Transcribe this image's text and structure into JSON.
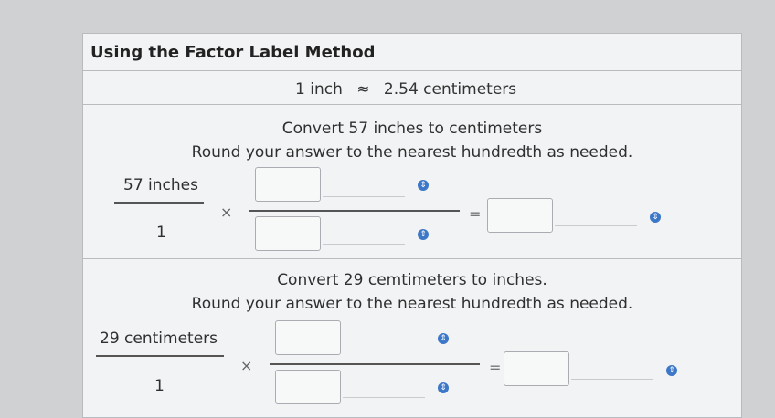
{
  "title": "Using the Factor Label Method",
  "equivalence": {
    "left": "1 inch",
    "symbol": "≈",
    "right": "2.54 centimeters"
  },
  "problem1": {
    "prompt": "Convert 57 inches to centimeters",
    "instruction": "Round your answer to the nearest hundredth as needed.",
    "numerator": "57 inches",
    "denominator": "1",
    "times": "×",
    "equals": "="
  },
  "problem2": {
    "prompt": "Convert 29 cemtimeters to inches.",
    "instruction": "Round your answer to the nearest hundredth as needed.",
    "numerator": "29 centimeters",
    "denominator": "1",
    "times": "×",
    "equals": "="
  },
  "icons": {
    "dropdown": "chevron-updown-icon"
  },
  "colors": {
    "accent": "#3d77c8",
    "panel": "#f2f3f4",
    "border": "#b9bcbf"
  }
}
